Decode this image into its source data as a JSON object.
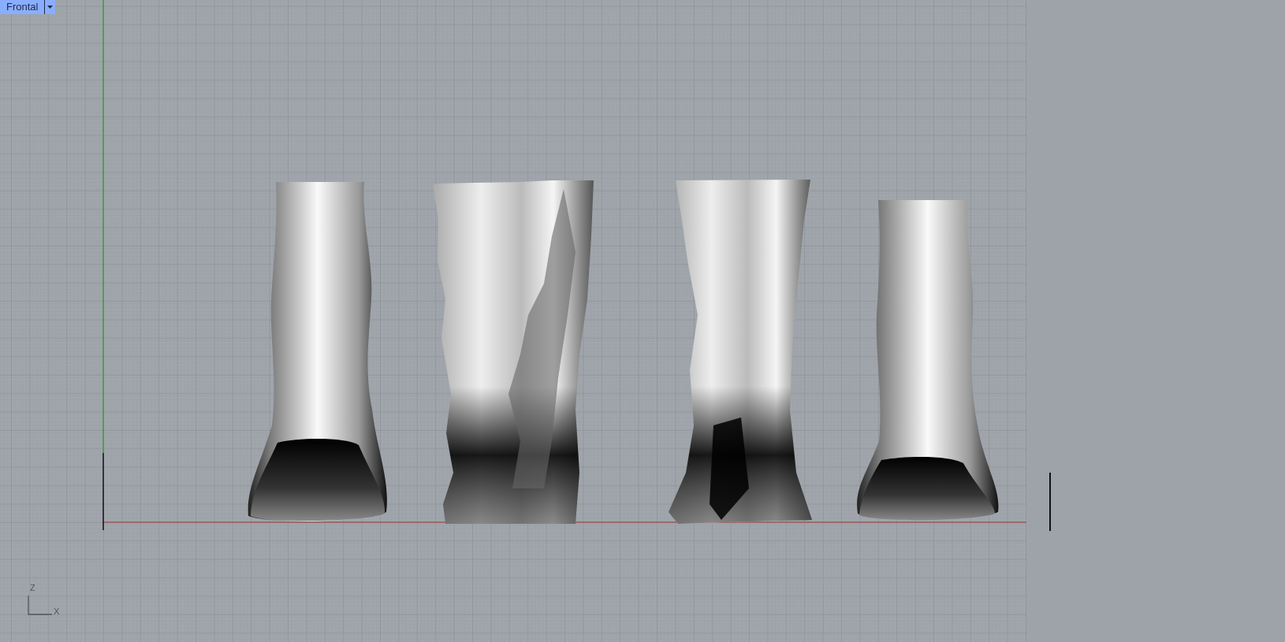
{
  "viewport": {
    "title": "Frontal",
    "axis_labels": [
      "Z",
      "X"
    ]
  }
}
